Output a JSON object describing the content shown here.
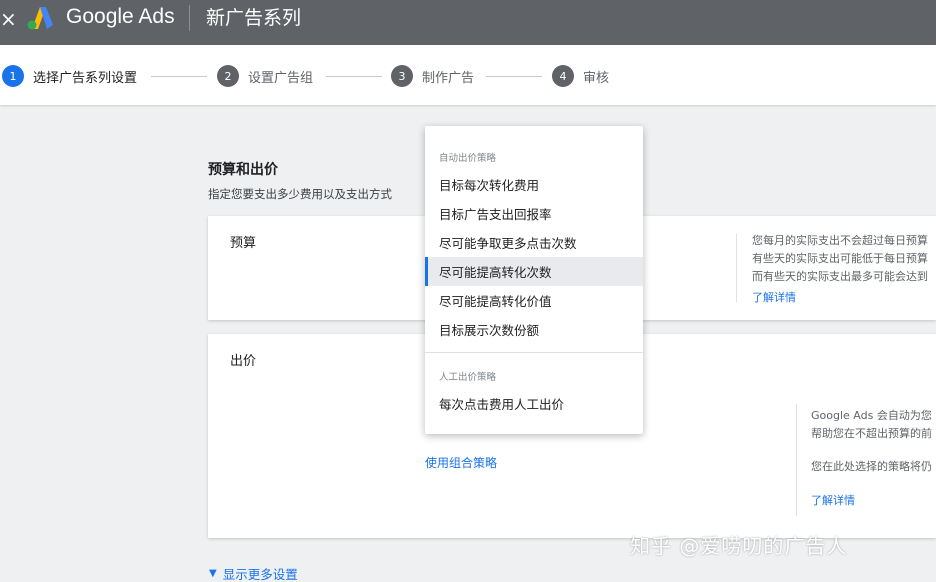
{
  "header": {
    "close_icon": "×",
    "brand": "Google Ads",
    "page_title": "新广告系列",
    "bg_color": "#5f6368"
  },
  "stepper": {
    "steps": [
      {
        "num": "1",
        "label": "选择广告系列设置"
      },
      {
        "num": "2",
        "label": "设置广告组"
      },
      {
        "num": "3",
        "label": "制作广告"
      },
      {
        "num": "4",
        "label": "审核"
      }
    ],
    "active_color": "#1a73e8"
  },
  "section": {
    "title": "预算和出价",
    "subtitle": "指定您要支出多少费用以及支出方式"
  },
  "budget_card": {
    "label": "预算",
    "help_lines": [
      "您每月的实际支出不会超过每日预算",
      "有些天的实际支出可能低于每日预算",
      "而有些天的实际支出最多可能会达到"
    ],
    "learn_more": "了解详情"
  },
  "bid_card": {
    "label": "出价",
    "help_lines": [
      "Google Ads 会自动为您",
      "帮助您在不超出预算的前"
    ],
    "help_line_2": "您在此处选择的策略将仍",
    "learn_more": "了解详情",
    "combo_link": "使用组合策略"
  },
  "dropdown": {
    "group_auto": "自动出价策略",
    "auto_items": [
      "目标每次转化费用",
      "目标广告支出回报率",
      "尽可能争取更多点击次数",
      "尽可能提高转化次数",
      "尽可能提高转化价值",
      "目标展示次数份额"
    ],
    "selected_index": 3,
    "group_manual": "人工出价策略",
    "manual_items": [
      "每次点击费用人工出价"
    ]
  },
  "more_settings": "显示更多设置",
  "watermark": "知乎 @爱唠叨的广告人"
}
